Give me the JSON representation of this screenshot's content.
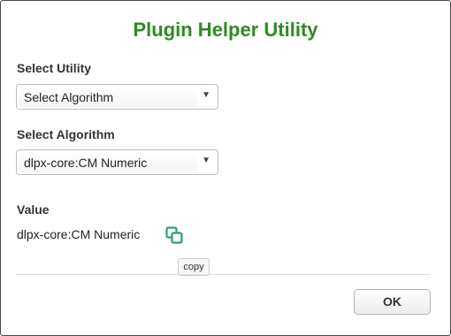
{
  "dialog": {
    "title": "Plugin Helper Utility"
  },
  "utility": {
    "label": "Select Utility",
    "selected": "Select Algorithm"
  },
  "algorithm": {
    "label": "Select Algorithm",
    "selected": "dlpx-core:CM Numeric"
  },
  "value": {
    "label": "Value",
    "text": "dlpx-core:CM Numeric",
    "copy_icon": "copy-icon",
    "tooltip": "copy"
  },
  "footer": {
    "ok_label": "OK"
  },
  "colors": {
    "title": "#2e8b22",
    "copy_icon": "#2e9c7e"
  }
}
